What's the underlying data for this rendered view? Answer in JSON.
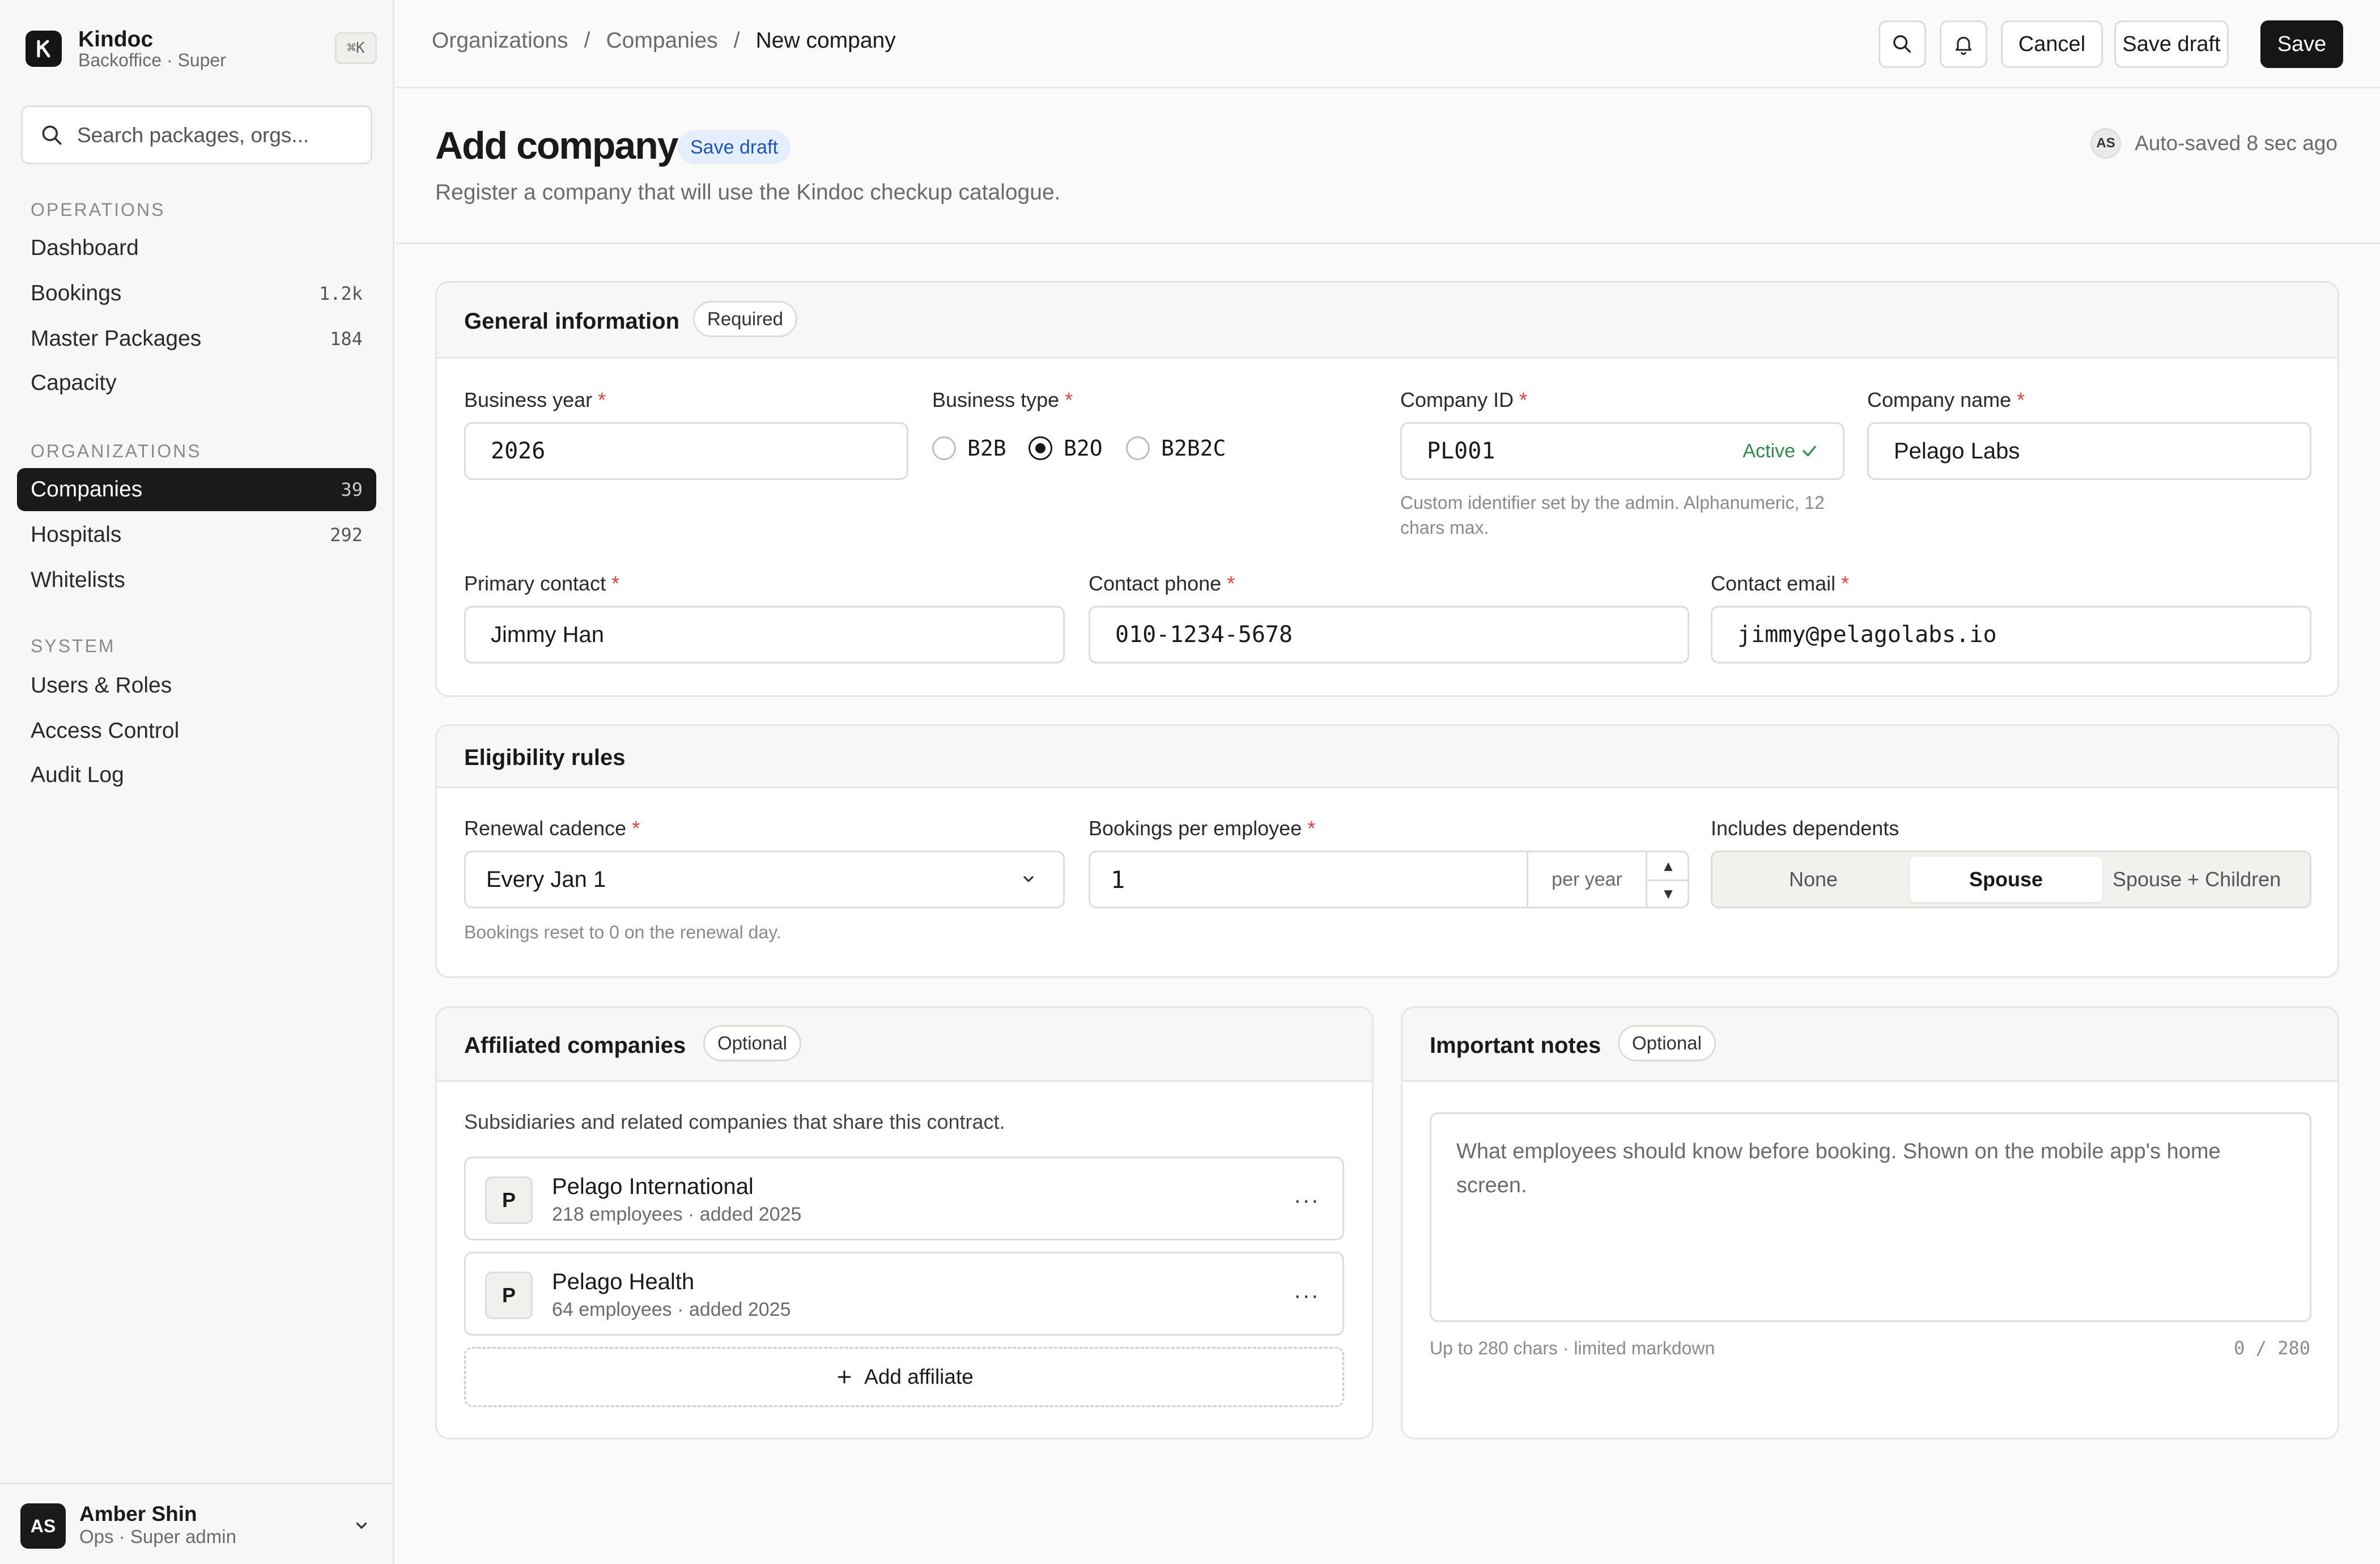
{
  "brand": {
    "name": "Kindoc",
    "sub": "Backoffice · Super",
    "shortcut": "⌘K"
  },
  "search": {
    "placeholder": "Search packages, orgs..."
  },
  "sidebar": {
    "sections": [
      {
        "title": "OPERATIONS",
        "items": [
          {
            "label": "Dashboard",
            "count": ""
          },
          {
            "label": "Bookings",
            "count": "1.2k"
          },
          {
            "label": "Master Packages",
            "count": "184"
          },
          {
            "label": "Capacity",
            "count": ""
          }
        ]
      },
      {
        "title": "ORGANIZATIONS",
        "items": [
          {
            "label": "Companies",
            "count": "39"
          },
          {
            "label": "Hospitals",
            "count": "292"
          },
          {
            "label": "Whitelists",
            "count": ""
          }
        ]
      },
      {
        "title": "SYSTEM",
        "items": [
          {
            "label": "Users & Roles",
            "count": ""
          },
          {
            "label": "Access Control",
            "count": ""
          },
          {
            "label": "Audit Log",
            "count": ""
          }
        ]
      }
    ]
  },
  "user": {
    "initials": "AS",
    "name": "Amber Shin",
    "role": "Ops · Super admin"
  },
  "breadcrumb": {
    "items": [
      "Organizations",
      "Companies",
      "New company"
    ],
    "sep": "/"
  },
  "toolbar": {
    "cancel": "Cancel",
    "save_draft": "Save draft",
    "save": "Save"
  },
  "page": {
    "title": "Add company",
    "badge": "Save draft",
    "subtitle": "Register a company that will use the Kindoc checkup catalogue.",
    "autosave_initials": "AS",
    "autosave": "Auto-saved 8 sec ago"
  },
  "general": {
    "title": "General information",
    "chip": "Required",
    "business_year": {
      "label": "Business year",
      "value": "2026"
    },
    "business_type": {
      "label": "Business type",
      "options": [
        "B2B",
        "B2O",
        "B2B2C"
      ],
      "selected": "B2O"
    },
    "company_id": {
      "label": "Company ID",
      "value": "PL001",
      "status": "Active",
      "hint": "Custom identifier set by the admin. Alphanumeric, 12 chars max."
    },
    "company_name": {
      "label": "Company name",
      "value": "Pelago Labs"
    },
    "primary_contact": {
      "label": "Primary contact",
      "value": "Jimmy Han"
    },
    "contact_phone": {
      "label": "Contact phone",
      "value": "010-1234-5678"
    },
    "contact_email": {
      "label": "Contact email",
      "value": "jimmy@pelagolabs.io"
    },
    "required_mark": "*"
  },
  "eligibility": {
    "title": "Eligibility rules",
    "renewal": {
      "label": "Renewal cadence",
      "value": "Every Jan 1",
      "hint": "Bookings reset to 0 on the renewal day."
    },
    "bookings": {
      "label": "Bookings per employee",
      "value": "1",
      "unit": "per year"
    },
    "dependents": {
      "label": "Includes dependents",
      "options": [
        "None",
        "Spouse",
        "Spouse + Children"
      ],
      "selected": "Spouse"
    }
  },
  "affiliates": {
    "title": "Affiliated companies",
    "chip": "Optional",
    "desc": "Subsidiaries and related companies that share this contract.",
    "items": [
      {
        "initial": "P",
        "name": "Pelago International",
        "meta": "218 employees · added 2025"
      },
      {
        "initial": "P",
        "name": "Pelago Health",
        "meta": "64 employees · added 2025"
      }
    ],
    "add_label": "Add affiliate"
  },
  "notes": {
    "title": "Important notes",
    "chip": "Optional",
    "placeholder": "What employees should know before booking. Shown on the mobile app's home screen.",
    "hint": "Up to 280 chars · limited markdown",
    "counter": "0 / 280"
  }
}
